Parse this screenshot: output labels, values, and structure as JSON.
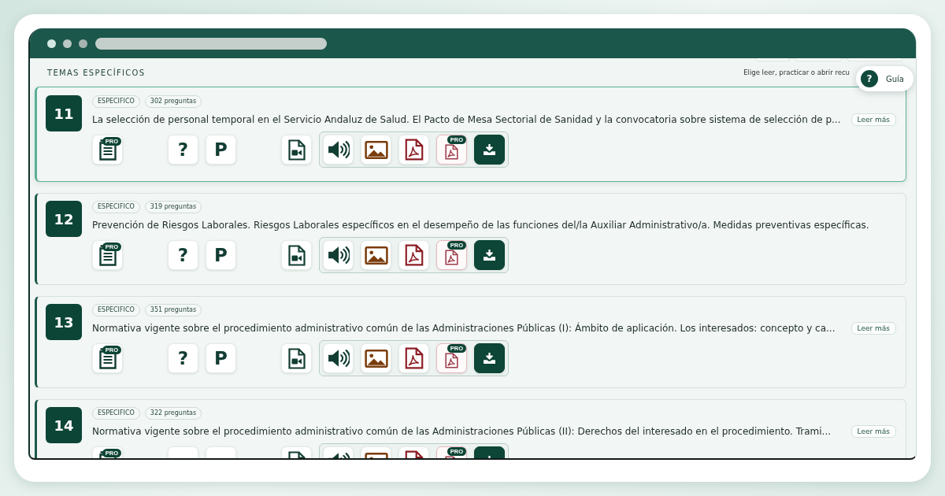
{
  "section": {
    "title": "TEMAS ESPECÍFICOS",
    "hint": "Elige leer, practicar o abrir recu"
  },
  "guide_button": {
    "icon": "?",
    "label": "Guía"
  },
  "cards": [
    {
      "number": "11",
      "selected": true,
      "tags": [
        "ESPECIFICO",
        "302 preguntas"
      ],
      "title": "La selección de personal temporal en el Servicio Andaluz de Salud. El Pacto de Mesa Sectorial de Sanidad y la convocatoria sobre sistema de selección de p...",
      "read_more": "Leer más",
      "action_groups": [
        [
          {
            "kind": "notes",
            "pro": true,
            "badge": "PRO"
          }
        ],
        [
          {
            "kind": "glyph",
            "label": "?"
          },
          {
            "kind": "glyph",
            "label": "P"
          }
        ],
        [
          {
            "kind": "video"
          }
        ]
      ],
      "resources": [
        {
          "kind": "audio"
        },
        {
          "kind": "image"
        },
        {
          "kind": "pdf"
        },
        {
          "kind": "pdf_pro",
          "pro": true,
          "badge": "PRO"
        },
        {
          "kind": "download"
        }
      ]
    },
    {
      "number": "12",
      "selected": false,
      "tags": [
        "ESPECIFICO",
        "319 preguntas"
      ],
      "title": "Prevención de Riesgos Laborales. Riesgos Laborales específicos en el desempeño de las funciones del/la Auxiliar Administrativo/a. Medidas preventivas específicas.",
      "action_groups": [
        [
          {
            "kind": "notes",
            "pro": true,
            "badge": "PRO"
          }
        ],
        [
          {
            "kind": "glyph",
            "label": "?"
          },
          {
            "kind": "glyph",
            "label": "P"
          }
        ],
        [
          {
            "kind": "video"
          }
        ]
      ],
      "resources": [
        {
          "kind": "audio"
        },
        {
          "kind": "image"
        },
        {
          "kind": "pdf"
        },
        {
          "kind": "pdf_pro",
          "pro": true,
          "badge": "PRO"
        },
        {
          "kind": "download"
        }
      ]
    },
    {
      "number": "13",
      "selected": false,
      "tags": [
        "ESPECIFICO",
        "351 preguntas"
      ],
      "title": "Normativa vigente sobre el procedimiento administrativo común de las Administraciones Públicas (I): Ámbito de aplicación. Los interesados: concepto y ca...",
      "read_more": "Leer más",
      "action_groups": [
        [
          {
            "kind": "notes",
            "pro": true,
            "badge": "PRO"
          }
        ],
        [
          {
            "kind": "glyph",
            "label": "?"
          },
          {
            "kind": "glyph",
            "label": "P"
          }
        ],
        [
          {
            "kind": "video"
          }
        ]
      ],
      "resources": [
        {
          "kind": "audio"
        },
        {
          "kind": "image"
        },
        {
          "kind": "pdf"
        },
        {
          "kind": "pdf_pro",
          "pro": true,
          "badge": "PRO"
        },
        {
          "kind": "download"
        }
      ]
    },
    {
      "number": "14",
      "selected": false,
      "tags": [
        "ESPECIFICO",
        "322 preguntas"
      ],
      "title": "Normativa vigente sobre el procedimiento administrativo común de las Administraciones Públicas (II): Derechos del interesado en el procedimiento. Trami...",
      "read_more": "Leer más",
      "action_groups": [
        [
          {
            "kind": "notes",
            "pro": true,
            "badge": "PRO"
          }
        ],
        [
          {
            "kind": "glyph"
          },
          {
            "kind": "glyph"
          }
        ],
        [
          {
            "kind": "video"
          }
        ]
      ],
      "resources": [
        {
          "kind": "audio"
        },
        {
          "kind": "image"
        },
        {
          "kind": "pdf"
        },
        {
          "kind": "pdf_pro",
          "pro": true,
          "badge": "PRO"
        },
        {
          "kind": "download"
        }
      ]
    }
  ]
}
